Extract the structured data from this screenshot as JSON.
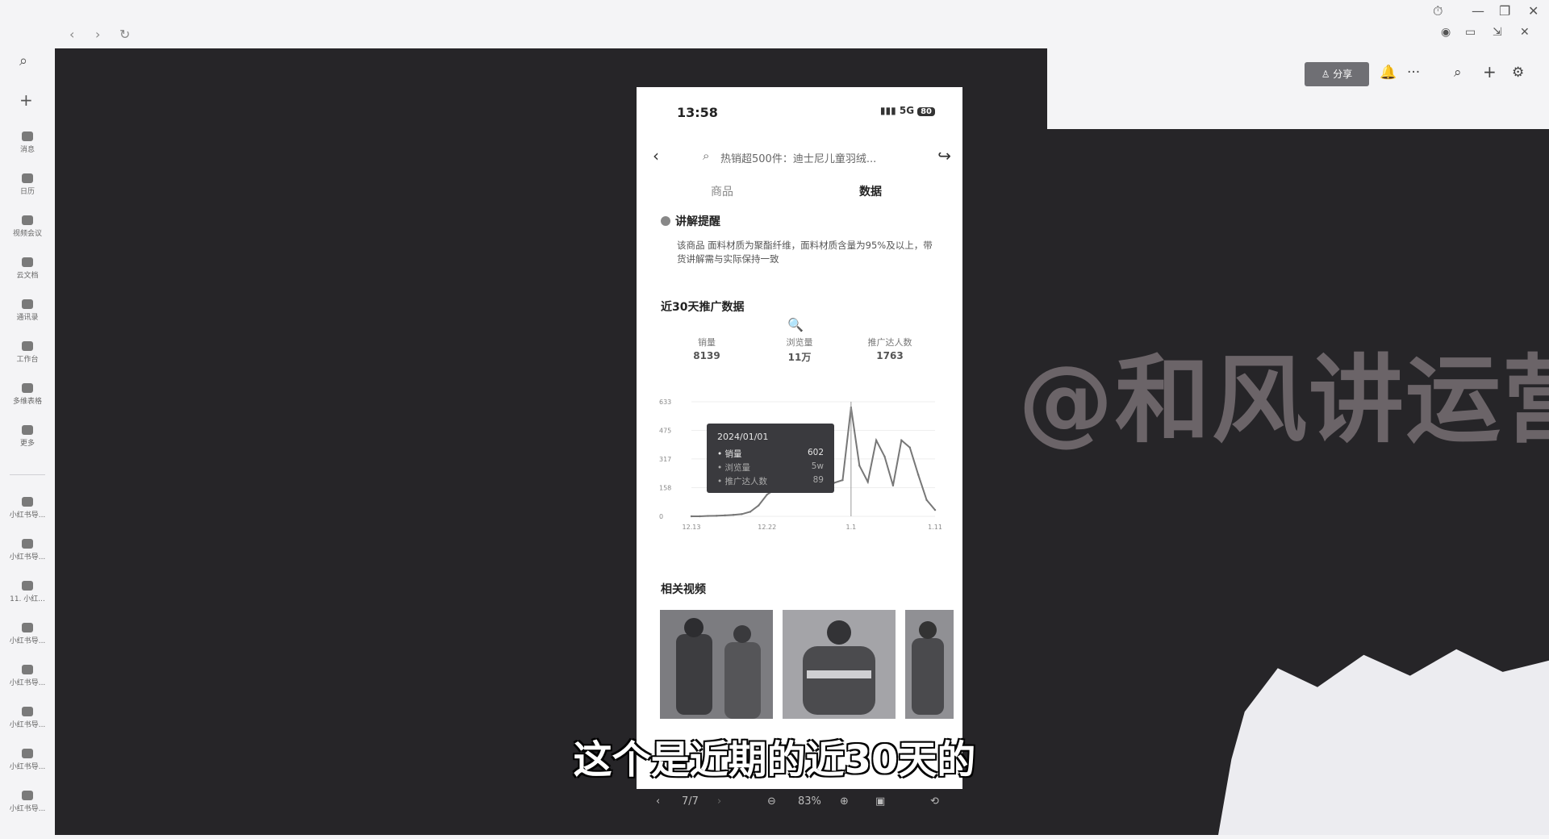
{
  "window": {
    "nav_back": "‹",
    "nav_forward": "›",
    "reload": "↻",
    "controls": [
      "⏱",
      "—",
      "❐",
      "✕"
    ],
    "controls2": [
      "◉",
      "▭",
      "⇲",
      "✕"
    ]
  },
  "rail": {
    "search_icon": "⌕",
    "add_icon": "+",
    "items": [
      "消息",
      "日历",
      "视频会议",
      "云文档",
      "通讯录",
      "工作台",
      "多维表格",
      "更多"
    ],
    "docs": [
      "小红书导...",
      "小红书导...",
      "11. 小红...",
      "小红书导...",
      "小红书导...",
      "小红书导...",
      "小红书导...",
      "小红书导..."
    ]
  },
  "toolbar": {
    "share_label": "分享",
    "bell_icon": "🔔",
    "more_icon": "···",
    "search_icon": "⌕",
    "add_icon": "+",
    "settings_icon": "⚙"
  },
  "watermark": "@和风讲运营",
  "phone": {
    "time": "13:58",
    "signal": "5G",
    "battery": "80",
    "search_text": "热销超500件：迪士尼儿童羽绒...",
    "tabs": [
      "商品",
      "数据"
    ],
    "tip_title": "讲解提醒",
    "tip_body": "该商品 面料材质为聚酯纤维，面料材质含量为95%及以上，带货讲解需与实际保持一致",
    "section_title": "近30天推广数据",
    "metrics": [
      {
        "label": "销量",
        "value": "8139"
      },
      {
        "label": "浏览量",
        "value": "11万"
      },
      {
        "label": "推广达人数",
        "value": "1763"
      }
    ],
    "tooltip": {
      "date": "2024/01/01",
      "rows": [
        {
          "label": "销量",
          "value": "602"
        },
        {
          "label": "浏览量",
          "value": "5w"
        },
        {
          "label": "推广达人数",
          "value": "89"
        }
      ]
    },
    "related_title": "相关视频"
  },
  "chart_data": {
    "type": "line",
    "x": [
      "12.13",
      "12.14",
      "12.15",
      "12.16",
      "12.17",
      "12.18",
      "12.19",
      "12.20",
      "12.21",
      "12.22",
      "12.23",
      "12.24",
      "12.25",
      "12.26",
      "12.27",
      "12.28",
      "12.29",
      "12.30",
      "12.31",
      "1.1",
      "1.2",
      "1.3",
      "1.4",
      "1.5",
      "1.6",
      "1.7",
      "1.8",
      "1.9",
      "1.10",
      "1.11"
    ],
    "xticks": [
      "12.13",
      "12.22",
      "1.1",
      "1.11"
    ],
    "yticks": [
      "633",
      "475",
      "317",
      "158",
      "0"
    ],
    "ylim": [
      0,
      633
    ],
    "series": [
      {
        "name": "销量",
        "values": [
          0,
          0,
          2,
          3,
          5,
          8,
          12,
          25,
          60,
          120,
          150,
          165,
          172,
          178,
          180,
          182,
          180,
          185,
          200,
          602,
          280,
          190,
          420,
          330,
          170,
          420,
          380,
          230,
          90,
          35
        ]
      }
    ]
  },
  "subtitle": "这个是近期的近30天的",
  "doc_toolbar": {
    "prev": "‹",
    "page": "7/7",
    "next": "›",
    "zoom_out": "⊖",
    "zoom": "83%",
    "zoom_in": "⊕",
    "fit": "▣",
    "rotate": "⟲"
  }
}
